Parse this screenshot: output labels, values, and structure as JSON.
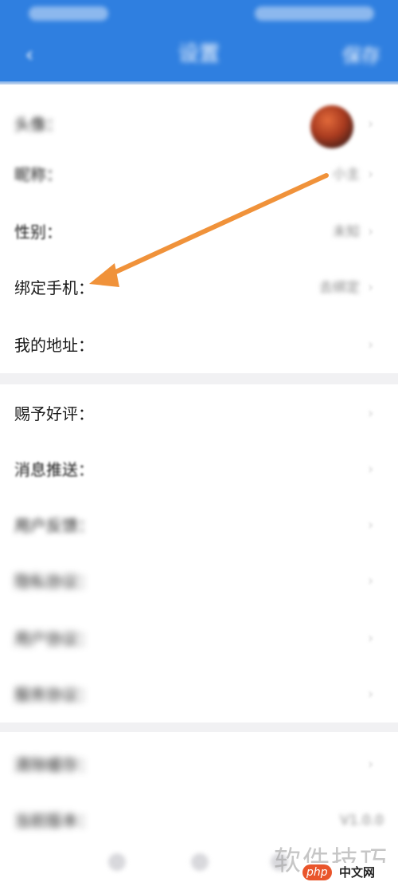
{
  "header": {
    "title": "设置",
    "action_label": "保存",
    "background_color": "#2f7fe0",
    "back_icon": "chevron-left-icon"
  },
  "profile_section": {
    "rows": [
      {
        "label": "头像：",
        "value": ""
      },
      {
        "label": "昵称：",
        "value": "小主"
      },
      {
        "label": "性别：",
        "value": "未知"
      },
      {
        "label": "绑定手机：",
        "value": "去绑定"
      },
      {
        "label": "我的地址：",
        "value": ""
      }
    ]
  },
  "settings_section": {
    "rows": [
      {
        "label": "赐予好评：",
        "value": ""
      },
      {
        "label": "消息推送：",
        "value": ""
      },
      {
        "label": "用户反馈：",
        "value": ""
      },
      {
        "label": "隐私协议：",
        "value": ""
      },
      {
        "label": "用户协议：",
        "value": ""
      },
      {
        "label": "服务协议：",
        "value": ""
      }
    ]
  },
  "misc_section": {
    "rows": [
      {
        "label": "清除缓存：",
        "value": ""
      },
      {
        "label": "当前版本：",
        "value": "V1.0.0"
      }
    ]
  },
  "annotation": {
    "arrow_color": "#f0923a",
    "points_to": "绑定手机"
  },
  "watermark": {
    "text": "软件技巧",
    "logo_badge": "php",
    "logo_site": "中文网"
  }
}
